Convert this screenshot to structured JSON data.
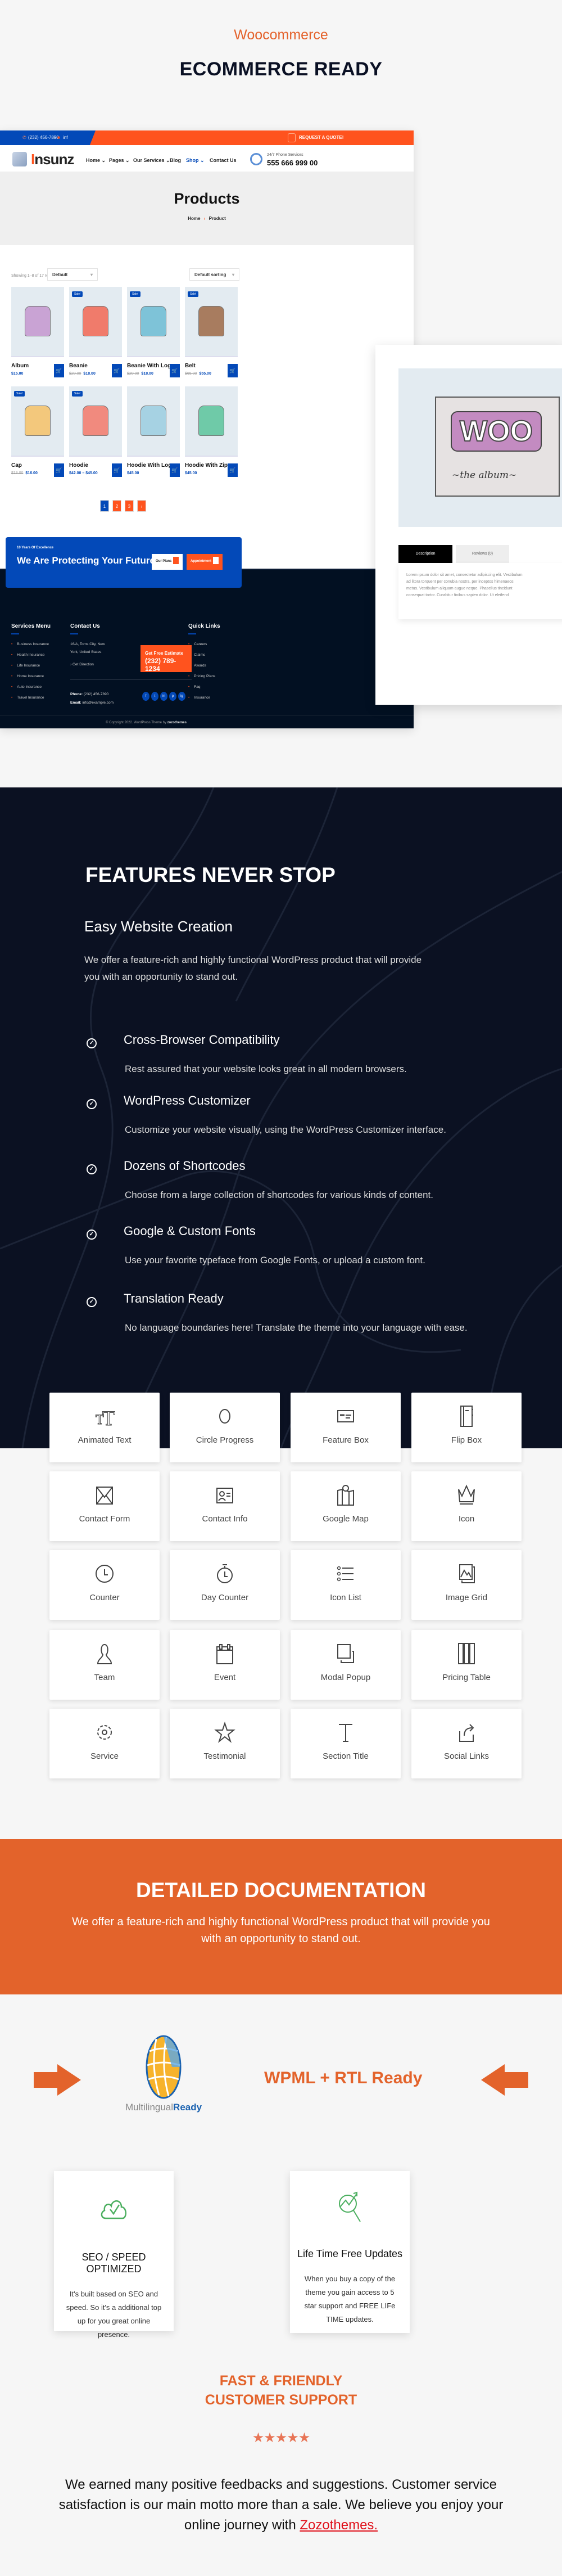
{
  "hero": {
    "subtitle": "Woocommerce",
    "title": "ECOMMERCE READY"
  },
  "mock_site": {
    "topbar": {
      "phone": "(232) 456-7890",
      "email_partial": "inf",
      "quote_button": "REQUEST A QUOTE!"
    },
    "logo": {
      "text": "nsunz",
      "initial": "I"
    },
    "nav": [
      {
        "label": "Home",
        "dropdown": true
      },
      {
        "label": "Pages",
        "dropdown": true
      },
      {
        "label": "Our Services",
        "dropdown": true
      },
      {
        "label": "Blog",
        "dropdown": false
      },
      {
        "label": "Shop",
        "dropdown": true,
        "active": true
      },
      {
        "label": "Contact Us",
        "dropdown": false
      }
    ],
    "phone_service": {
      "label": "24/7 Phone Services",
      "number": "555 666 999 00"
    },
    "banner": {
      "title": "Products",
      "breadcrumb_home": "Home",
      "breadcrumb_sep": "›",
      "breadcrumb_current": "Product"
    },
    "shop": {
      "result_count": "Showing 1–8 of 17 results",
      "per_page_select": "Default",
      "sort_select": "Default sorting",
      "sale_badge": "Sale!",
      "products": [
        {
          "name": "Album",
          "old_price": "",
          "price": "$15.00",
          "sale": false,
          "color": "#c9a3d4"
        },
        {
          "name": "Beanie",
          "old_price": "$20.00",
          "price": "$18.00",
          "sale": true,
          "color": "#f07b6b"
        },
        {
          "name": "Beanie With Logo",
          "old_price": "$20.00",
          "price": "$18.00",
          "sale": true,
          "color": "#7ec3d8"
        },
        {
          "name": "Belt",
          "old_price": "$65.00",
          "price": "$55.00",
          "sale": true,
          "color": "#a87c5f"
        },
        {
          "name": "Cap",
          "old_price": "$18.00",
          "price": "$16.00",
          "sale": true,
          "color": "#f3c87c"
        },
        {
          "name": "Hoodie",
          "old_price": "",
          "price": "$42.00 – $45.00",
          "sale": true,
          "color": "#f18a7e"
        },
        {
          "name": "Hoodie With Logo",
          "old_price": "",
          "price": "$45.00",
          "sale": false,
          "color": "#a6d2e3"
        },
        {
          "name": "Hoodie With Zipper",
          "old_price": "",
          "price": "$45.00",
          "sale": false,
          "color": "#6fcaa8"
        }
      ],
      "pagination": [
        "1",
        "2",
        "3",
        "›"
      ]
    },
    "cta": {
      "kicker": "10 Years Of Excellence",
      "title": "We Are Protecting Your Future.",
      "btn_plans": "Our Plans",
      "btn_appointment": "Appointment"
    },
    "footer": {
      "services_title": "Services Menu",
      "services": [
        "Business Insurance",
        "Health Insurance",
        "Life Insurance",
        "Home Insurance",
        "Auto Insurance",
        "Travel Insurance"
      ],
      "contact_title": "Contact Us",
      "address_line1": "16/A, Toms City, New",
      "address_line2": "York, United States",
      "direction": "Get Direction",
      "estimate_label": "Get Free Estimate",
      "estimate_phone": "(232) 789-1234",
      "phone_label": "Phone:",
      "phone": "(232) 456-7890",
      "email_label": "Email:",
      "email": "info@example.com",
      "social": [
        "f",
        "t",
        "in",
        "p",
        "ig"
      ],
      "quick_title": "Quick Links",
      "quick_links": [
        "Careers",
        "Claims",
        "Awards",
        "Pricing Plans",
        "Faq",
        "Insurance"
      ],
      "copyright": "© Copyright 2022. WordPress Theme by",
      "copyright_brand": "zozothemes"
    }
  },
  "product_detail": {
    "album_text_top": "WOO",
    "album_text_bottom": "~the  album~",
    "tabs": [
      {
        "label": "Description",
        "active": true
      },
      {
        "label": "Reviews (0)",
        "active": false
      }
    ],
    "description_lines": [
      "Lorem ipsum dolor sit amet, consectetur adipiscing elit. Vestibulum",
      "ad litora torquent per conubia nostra, per inceptos himenaeos",
      "metus. Vestibulum aliquam augue neque. Phasellus tincidunt",
      "consequat tortor. Curabitur finibus sapien dolor. Ut eleifend"
    ]
  },
  "features": {
    "title": "FEATURES NEVER STOP",
    "subtitle": "Easy Website Creation",
    "intro": "We offer a feature-rich and highly functional WordPress product that will provide you with an opportunity to stand out.",
    "items": [
      {
        "title": "Cross-Browser Compatibility",
        "text": "Rest assured that your website looks great in all modern browsers."
      },
      {
        "title": "WordPress Customizer",
        "text": "Customize your website visually, using the WordPress Customizer interface."
      },
      {
        "title": "Dozens of Shortcodes",
        "text": "Choose from a large collection of shortcodes for various kinds of content."
      },
      {
        "title": "Google & Custom Fonts",
        "text": "Use your favorite typeface from Google Fonts, or upload a custom font."
      },
      {
        "title": "Translation Ready",
        "text": "No language boundaries here! Translate the theme into your language with ease."
      }
    ],
    "widgets": [
      {
        "label": "Animated Text",
        "icon": "text-size-icon"
      },
      {
        "label": "Circle Progress",
        "icon": "circle-icon"
      },
      {
        "label": "Feature Box",
        "icon": "feature-box-icon"
      },
      {
        "label": "Flip Box",
        "icon": "notebook-icon"
      },
      {
        "label": "Contact Form",
        "icon": "envelope-icon"
      },
      {
        "label": "Contact Info",
        "icon": "id-card-icon"
      },
      {
        "label": "Google Map",
        "icon": "map-pin-icon"
      },
      {
        "label": "Icon",
        "icon": "crown-icon"
      },
      {
        "label": "Counter",
        "icon": "clock-icon"
      },
      {
        "label": "Day Counter",
        "icon": "stopwatch-icon"
      },
      {
        "label": "Icon List",
        "icon": "list-icon"
      },
      {
        "label": "Image Grid",
        "icon": "image-gallery-icon"
      },
      {
        "label": "Team",
        "icon": "person-icon"
      },
      {
        "label": "Event",
        "icon": "calendar-icon"
      },
      {
        "label": "Modal Popup",
        "icon": "copy-icon"
      },
      {
        "label": "Pricing Table",
        "icon": "columns-icon"
      },
      {
        "label": "Service",
        "icon": "gear-icon"
      },
      {
        "label": "Testimonial",
        "icon": "star-icon"
      },
      {
        "label": "Section Title",
        "icon": "letter-t-icon"
      },
      {
        "label": "Social Links",
        "icon": "share-icon"
      }
    ]
  },
  "documentation": {
    "title": "DETAILED  DOCUMENTATION",
    "text": "We offer a feature-rich and highly functional WordPress product that will provide you with an opportunity to stand out."
  },
  "wpml": {
    "logo_text_gray": "Multilingual",
    "logo_text_blue": "Ready",
    "title": "WPML + RTL Ready"
  },
  "cards": [
    {
      "title": "SEO / SPEED OPTIMIZED",
      "text": "It's built based on SEO and speed. So it's a additional top up for you great online presence.",
      "icon": "cloud-check-icon"
    },
    {
      "title": "Life Time Free Updates",
      "text": "When you buy a copy of the theme you gain access to 5 star support and FREE LIFe TIME updates.",
      "icon": "chart-search-icon"
    }
  ],
  "support": {
    "title_line1": "FAST & FRIENDLY",
    "title_line2": "CUSTOMER SUPPORT",
    "rating": 5,
    "rating_max": 5,
    "text": "We earned many positive feedbacks and suggestions. Customer service satisfaction is our main motto more than a sale. We believe you enjoy your online journey with",
    "link": "Zozothemes."
  },
  "colors": {
    "accent_orange": "#e4622b",
    "mock_orange": "#ff531e",
    "mock_blue": "#0349b8",
    "dark_navy": "#0b1122",
    "footer_navy": "#021022",
    "link_red": "#e0101a",
    "green_icon": "#4caf60"
  }
}
